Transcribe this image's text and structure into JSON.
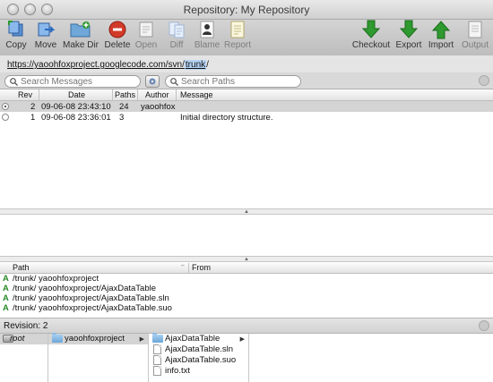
{
  "window": {
    "title": "Repository: My Repository"
  },
  "toolbar": {
    "left": [
      {
        "id": "copy",
        "label": "Copy",
        "icon": "copy-icon"
      },
      {
        "id": "move",
        "label": "Move",
        "icon": "move-icon"
      },
      {
        "id": "makedir",
        "label": "Make Dir",
        "icon": "make-dir-icon"
      },
      {
        "id": "delete",
        "label": "Delete",
        "icon": "delete-icon"
      },
      {
        "id": "open",
        "label": "Open",
        "icon": "open-icon"
      },
      {
        "id": "diff",
        "label": "Diff",
        "icon": "diff-icon"
      },
      {
        "id": "blame",
        "label": "Blame",
        "icon": "blame-icon"
      },
      {
        "id": "report",
        "label": "Report",
        "icon": "report-icon"
      }
    ],
    "right": [
      {
        "id": "checkout",
        "label": "Checkout",
        "icon": "checkout-icon"
      },
      {
        "id": "export",
        "label": "Export",
        "icon": "export-icon"
      },
      {
        "id": "import",
        "label": "Import",
        "icon": "import-icon"
      },
      {
        "id": "output",
        "label": "Output",
        "icon": "output-icon"
      }
    ]
  },
  "url": {
    "prefix": "https://yaoohfoxproject.googlecode.com/svn/",
    "selected": "trunk",
    "suffix": "/"
  },
  "search": {
    "messages_placeholder": "Search Messages",
    "paths_placeholder": "Search Paths"
  },
  "log": {
    "columns": {
      "rev": "Rev",
      "date": "Date",
      "paths": "Paths",
      "author": "Author",
      "message": "Message"
    },
    "rows": [
      {
        "rev": "2",
        "date": "09-06-08 23:43:10",
        "paths": "24",
        "author": "yaoohfox",
        "message": "",
        "selected": true
      },
      {
        "rev": "1",
        "date": "09-06-08 23:36:01",
        "paths": "3",
        "author": "",
        "message": "Initial directory structure.",
        "selected": false
      }
    ]
  },
  "paths": {
    "columns": {
      "path": "Path",
      "from": "From"
    },
    "rows": [
      {
        "action": "A",
        "path": "/trunk/ yaoohfoxproject"
      },
      {
        "action": "A",
        "path": "/trunk/ yaoohfoxproject/AjaxDataTable"
      },
      {
        "action": "A",
        "path": "/trunk/ yaoohfoxproject/AjaxDataTable.sln"
      },
      {
        "action": "A",
        "path": "/trunk/ yaoohfoxproject/AjaxDataTable.suo"
      }
    ]
  },
  "revision": {
    "label": "Revision:",
    "value": "2"
  },
  "browser": {
    "root": "root",
    "project": "yaoohfoxproject",
    "items": [
      "AjaxDataTable",
      "AjaxDataTable.sln",
      "AjaxDataTable.suo",
      "info.txt"
    ]
  },
  "colors": {
    "selection": "#d4d4d4",
    "url_highlight": "#b5d3f3",
    "added": "#2a8a2a",
    "delete_red": "#d23a2a",
    "checkout_green": "#2f9a2f"
  }
}
